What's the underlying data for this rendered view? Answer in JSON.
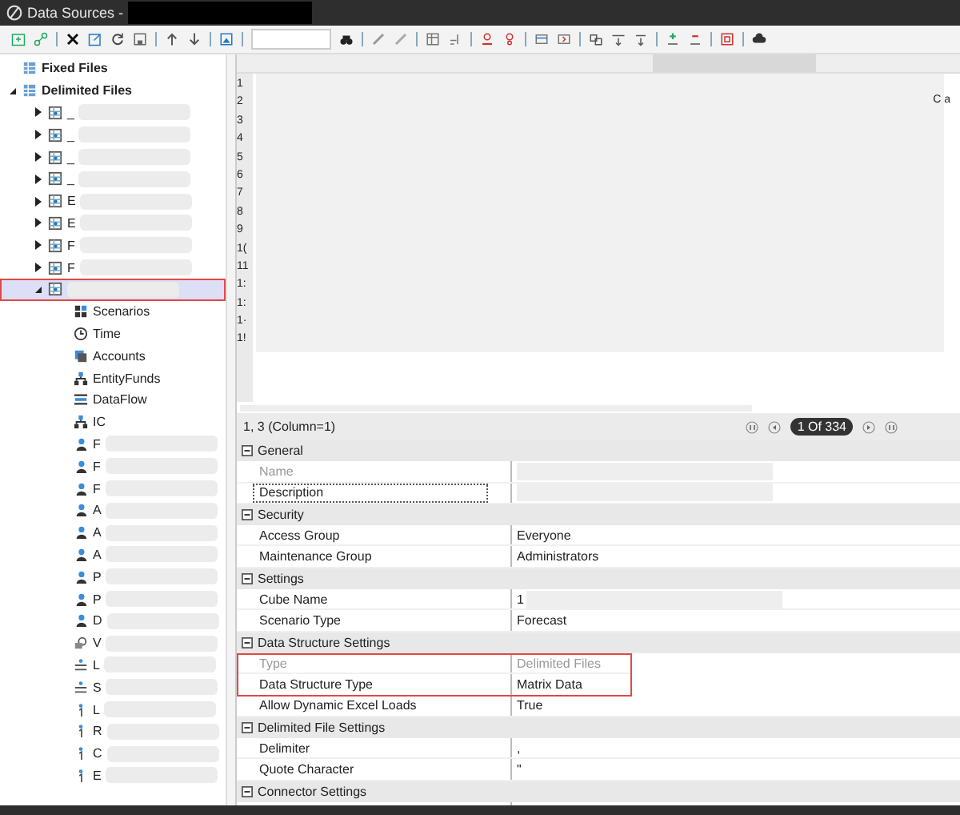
{
  "window": {
    "title": "Data Sources -"
  },
  "tree": {
    "items": [
      {
        "label": "Fixed Files",
        "kind": "folder",
        "selected": false,
        "highlighted": false
      },
      {
        "label": "Delimited Files",
        "kind": "folder",
        "expanded": true,
        "selected": false,
        "highlighted": false,
        "children": [
          {
            "label": "_",
            "kind": "source",
            "expanded": false,
            "selected": false,
            "highlighted": false
          },
          {
            "label": "_",
            "kind": "source",
            "expanded": false,
            "selected": false,
            "highlighted": false
          },
          {
            "label": "_",
            "kind": "source",
            "expanded": false,
            "selected": false,
            "highlighted": false
          },
          {
            "label": "_",
            "kind": "source",
            "expanded": false,
            "selected": false,
            "highlighted": false
          },
          {
            "label": "E",
            "kind": "source",
            "expanded": false,
            "selected": false,
            "highlighted": false
          },
          {
            "label": "E",
            "kind": "source",
            "expanded": false,
            "selected": false,
            "highlighted": false
          },
          {
            "label": "F",
            "kind": "source",
            "expanded": false,
            "selected": false,
            "highlighted": false
          },
          {
            "label": "F",
            "kind": "source",
            "expanded": false,
            "selected": false,
            "highlighted": false
          },
          {
            "kind": "source",
            "expanded": true,
            "selected": true,
            "highlighted": true,
            "children": [
              {
                "label": "Scenarios",
                "kind": "scenarios"
              },
              {
                "label": "Time",
                "kind": "time"
              },
              {
                "label": "Accounts",
                "kind": "accounts"
              },
              {
                "label": "EntityFunds",
                "kind": "entity"
              },
              {
                "label": "DataFlow",
                "kind": "flow"
              },
              {
                "label": "IC",
                "kind": "entity"
              },
              {
                "label": "F",
                "kind": "ud"
              },
              {
                "label": "F",
                "kind": "ud"
              },
              {
                "label": "F",
                "kind": "ud"
              },
              {
                "label": "A",
                "kind": "ud"
              },
              {
                "label": "A",
                "kind": "ud"
              },
              {
                "label": "A",
                "kind": "ud"
              },
              {
                "label": "P",
                "kind": "ud"
              },
              {
                "label": "P",
                "kind": "ud"
              },
              {
                "label": "D",
                "kind": "ud"
              },
              {
                "label": "V",
                "kind": "view"
              },
              {
                "label": "L",
                "kind": "txt"
              },
              {
                "label": "S",
                "kind": "txt"
              },
              {
                "label": "L",
                "kind": "num"
              },
              {
                "label": "R",
                "kind": "num"
              },
              {
                "label": "C",
                "kind": "num"
              },
              {
                "label": "E",
                "kind": "num"
              }
            ]
          }
        ]
      }
    ]
  },
  "grid": {
    "row_numbers": [
      "1",
      "2",
      "3",
      "4",
      "5",
      "6",
      "7",
      "8",
      "9",
      "1(",
      "11",
      "1:",
      "1:",
      "1·",
      "1!"
    ],
    "cell_text": "C a"
  },
  "status": {
    "position": "1, 3  (Column=1)",
    "page": "1 Of 334"
  },
  "properties": [
    {
      "category": "General",
      "expanded": true,
      "rows": [
        {
          "name": "Name",
          "disabled": true,
          "focused": false,
          "highlighted": false,
          "redacted": true
        },
        {
          "name": "Description",
          "disabled": false,
          "focused": true,
          "highlighted": false,
          "redacted": true
        }
      ]
    },
    {
      "category": "Security",
      "expanded": true,
      "rows": [
        {
          "name": "Access Group",
          "value": "Everyone",
          "disabled": false,
          "focused": false,
          "highlighted": false,
          "redacted": false
        },
        {
          "name": "Maintenance Group",
          "value": "Administrators",
          "disabled": false,
          "focused": false,
          "highlighted": false,
          "redacted": false
        }
      ]
    },
    {
      "category": "Settings",
      "expanded": true,
      "rows": [
        {
          "name": "Cube Name",
          "value": "1",
          "disabled": false,
          "focused": false,
          "highlighted": false,
          "redacted": true
        },
        {
          "name": "Scenario Type",
          "value": "Forecast",
          "disabled": false,
          "focused": false,
          "highlighted": false,
          "redacted": false
        }
      ]
    },
    {
      "category": "Data Structure Settings",
      "expanded": true,
      "rows": [
        {
          "name": "Type",
          "value": "Delimited Files",
          "disabled": true,
          "focused": false,
          "highlighted": true,
          "redacted": false
        },
        {
          "name": "Data Structure Type",
          "value": "Matrix Data",
          "disabled": false,
          "focused": false,
          "highlighted": true,
          "redacted": false
        },
        {
          "name": "Allow Dynamic Excel Loads",
          "value": "True",
          "disabled": false,
          "focused": false,
          "highlighted": false,
          "redacted": false
        }
      ]
    },
    {
      "category": "Delimited File Settings",
      "expanded": true,
      "rows": [
        {
          "name": "Delimiter",
          "value": ",",
          "disabled": false,
          "focused": false,
          "highlighted": false,
          "redacted": false
        },
        {
          "name": "Quote Character",
          "value": "\"",
          "disabled": false,
          "focused": false,
          "highlighted": false,
          "redacted": false
        }
      ]
    },
    {
      "category": "Connector Settings",
      "expanded": true
    }
  ]
}
